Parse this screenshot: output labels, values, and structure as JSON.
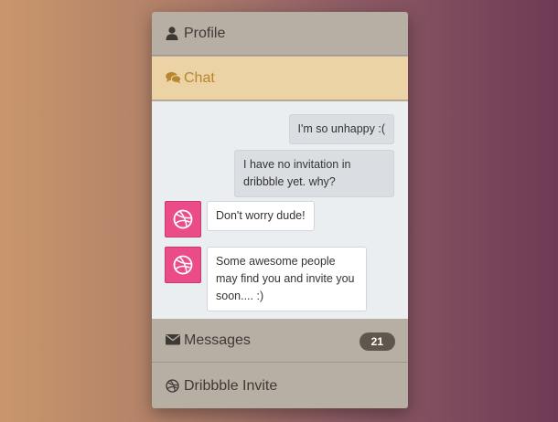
{
  "accordion": {
    "profile_label": "Profile",
    "chat_label": "Chat",
    "messages_label": "Messages",
    "messages_count": "21",
    "invite_label": "Dribbble Invite"
  },
  "chat": {
    "messages": [
      {
        "from": "me",
        "text": "I'm so unhappy :("
      },
      {
        "from": "me",
        "text": "I have no invitation in dribbble yet. why?"
      },
      {
        "from": "dribbble",
        "text": "Don't worry dude!"
      },
      {
        "from": "dribbble",
        "text": "Some awesome people may find you and invite you soon.... :)"
      }
    ]
  },
  "colors": {
    "chat_active_bg": "#ecd3a6",
    "chat_active_text": "#b8862e",
    "dribbble_pink": "#ea4c89",
    "badge_bg": "#5f574e"
  },
  "icons": {
    "profile": "user-icon",
    "chat": "comments-icon",
    "messages": "envelope-icon",
    "invite": "dribbble-icon",
    "avatar": "dribbble-icon"
  }
}
